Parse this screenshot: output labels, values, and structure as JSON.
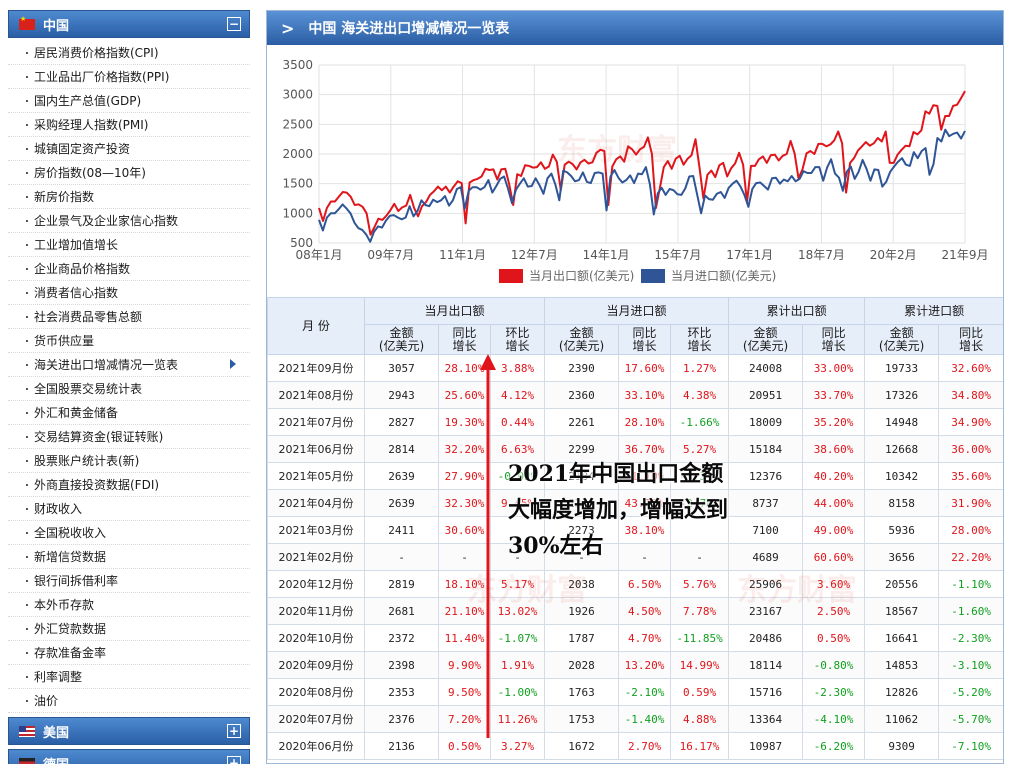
{
  "sidebar": {
    "groups": [
      {
        "name": "中国",
        "toggle": "−",
        "items": [
          "居民消费价格指数(CPI)",
          "工业品出厂价格指数(PPI)",
          "国内生产总值(GDP)",
          "采购经理人指数(PMI)",
          "城镇固定资产投资",
          "房价指数(08—10年)",
          "新房价指数",
          "企业景气及企业家信心指数",
          "工业增加值增长",
          "企业商品价格指数",
          "消费者信心指数",
          "社会消费品零售总额",
          "货币供应量",
          "海关进出口增减情况一览表",
          "全国股票交易统计表",
          "外汇和黄金储备",
          "交易结算资金(银证转账)",
          "股票账户统计表(新)",
          "外商直接投资数据(FDI)",
          "财政收入",
          "全国税收收入",
          "新增信贷数据",
          "银行间拆借利率",
          "本外币存款",
          "外汇贷款数据",
          "存款准备金率",
          "利率调整",
          "油价"
        ]
      },
      {
        "name": "美国",
        "toggle": "+"
      },
      {
        "name": "德国",
        "toggle": "+"
      }
    ]
  },
  "main": {
    "title": "中国 海关进出口增减情况一览表"
  },
  "chart_data": {
    "type": "line",
    "x_ticks": [
      "08年1月",
      "09年7月",
      "11年1月",
      "12年7月",
      "14年1月",
      "15年7月",
      "17年1月",
      "18年7月",
      "20年2月",
      "21年9月"
    ],
    "ylim": [
      500,
      3500
    ],
    "y_ticks": [
      500,
      1000,
      1500,
      2000,
      2500,
      3000,
      3500
    ],
    "grid": true,
    "legend_position": "bottom",
    "series": [
      {
        "name": "当月出口额(亿美元)",
        "color": "#e0151b",
        "values": [
          1090,
          870,
          1090,
          1200,
          1200,
          1280,
          1360,
          1350,
          1280,
          1140,
          1150,
          1110,
          1000,
          640,
          770,
          910,
          890,
          960,
          1050,
          1160,
          1040,
          1100,
          1130,
          1310,
          1090,
          950,
          1120,
          1190,
          1310,
          1370,
          1450,
          1390,
          1450,
          1350,
          1450,
          1540,
          1510,
          830,
          1520,
          1560,
          1580,
          1620,
          1750,
          1730,
          1740,
          1570,
          1740,
          1750,
          1490,
          1140,
          1660,
          1630,
          1810,
          1800,
          1770,
          1780,
          1860,
          1750,
          1790,
          1990,
          1870,
          1390,
          1820,
          1870,
          1830,
          1740,
          1860,
          1900,
          1840,
          1860,
          2020,
          2070,
          2050,
          1140,
          1790,
          1910,
          1960,
          1870,
          2130,
          2080,
          1990,
          2080,
          2120,
          2280,
          2000,
          1090,
          1420,
          1780,
          1880,
          1750,
          1920,
          1970,
          1820,
          1920,
          1980,
          2250,
          1770,
          1250,
          1650,
          1720,
          1610,
          1810,
          1850,
          1620,
          1760,
          1840,
          2020,
          1820,
          1190,
          1800,
          1800,
          1910,
          1960,
          1850,
          1980,
          1990,
          1890,
          1970,
          2000,
          2220,
          2010,
          1590,
          1740,
          2010,
          2050,
          2000,
          2170,
          2170,
          2130,
          2160,
          2230,
          2380,
          2180,
          1350,
          1850,
          1930,
          2060,
          2130,
          2200,
          2140,
          2180,
          2270,
          2210,
          2380,
          1850,
          1850,
          1990,
          2070,
          2140,
          2130,
          2370,
          2330,
          2400,
          2720,
          2680,
          2820,
          2810,
          2410,
          2640,
          2640,
          2810,
          2830,
          2940,
          3060
        ]
      },
      {
        "name": "当月进口额(亿美元)",
        "color": "#2f5597",
        "values": [
          890,
          710,
          930,
          1000,
          1000,
          1070,
          1150,
          1080,
          1000,
          840,
          750,
          720,
          640,
          520,
          690,
          780,
          760,
          880,
          960,
          970,
          930,
          900,
          930,
          1120,
          950,
          1040,
          1220,
          1140,
          1120,
          1230,
          1190,
          1220,
          1290,
          1130,
          1220,
          1410,
          1440,
          1080,
          1380,
          1440,
          1440,
          1400,
          1440,
          1560,
          1350,
          1460,
          1580,
          1620,
          1410,
          1170,
          1400,
          1500,
          1590,
          1450,
          1460,
          1590,
          1470,
          1330,
          1590,
          1670,
          1490,
          1220,
          1720,
          1690,
          1630,
          1540,
          1560,
          1690,
          1530,
          1510,
          1680,
          1690,
          1670,
          1050,
          1620,
          1730,
          1600,
          1520,
          1560,
          1640,
          1510,
          1670,
          1660,
          1780,
          1490,
          980,
          1340,
          1430,
          1310,
          1410,
          1390,
          1320,
          1310,
          1420,
          1620,
          1630,
          1320,
          1000,
          1300,
          1240,
          1230,
          1330,
          1360,
          1260,
          1430,
          1500,
          1550,
          1450,
          1310,
          1110,
          1410,
          1510,
          1520,
          1460,
          1400,
          1590,
          1600,
          1500,
          1570,
          1540,
          1630,
          1540,
          1580,
          1710,
          1680,
          1680,
          1780,
          1780,
          1550,
          1770,
          1910,
          1670,
          1600,
          1380,
          1700,
          1790,
          1580,
          1700,
          1900,
          1750,
          1550,
          1740,
          1730,
          1450,
          1530,
          1700,
          1790,
          1870,
          1930,
          1820,
          1800,
          2030,
          1930,
          2050,
          2100,
          1650,
          1830,
          2270,
          2210,
          2410,
          2300,
          2340,
          2360,
          2260,
          2390
        ]
      }
    ],
    "title": "",
    "xlabel": "",
    "ylabel": ""
  },
  "table": {
    "headers": {
      "month": "月    份",
      "groups": [
        "当月出口额",
        "当月进口额",
        "累计出口额",
        "累计进口额"
      ],
      "subs": [
        [
          "金额\n(亿美元)",
          "同比\n增长",
          "环比\n增长"
        ],
        [
          "金额\n(亿美元)",
          "同比\n增长",
          "环比\n增长"
        ],
        [
          "金额\n(亿美元)",
          "同比\n增长"
        ],
        [
          "金额\n(亿美元)",
          "同比\n增长"
        ]
      ]
    },
    "rows": [
      [
        "2021年09月份",
        "3057",
        "28.10%",
        "3.88%",
        "2390",
        "17.60%",
        "1.27%",
        "24008",
        "33.00%",
        "19733",
        "32.60%"
      ],
      [
        "2021年08月份",
        "2943",
        "25.60%",
        "4.12%",
        "2360",
        "33.10%",
        "4.38%",
        "20951",
        "33.70%",
        "17326",
        "34.80%"
      ],
      [
        "2021年07月份",
        "2827",
        "19.30%",
        "0.44%",
        "2261",
        "28.10%",
        "-1.66%",
        "18009",
        "35.20%",
        "14948",
        "34.90%"
      ],
      [
        "2021年06月份",
        "2814",
        "32.20%",
        "6.63%",
        "2299",
        "36.70%",
        "5.27%",
        "15184",
        "38.60%",
        "12668",
        "36.00%"
      ],
      [
        "2021年05月份",
        "2639",
        "27.90%",
        "-0.02%",
        "2184",
        "51.10%",
        "-1.37%",
        "12376",
        "40.20%",
        "10342",
        "35.60%"
      ],
      [
        "2021年04月份",
        "2639",
        "32.30%",
        "9.45%",
        "2211",
        "43.10%",
        "-2.78%",
        "8737",
        "44.00%",
        "8158",
        "31.90%"
      ],
      [
        "2021年03月份",
        "2411",
        "30.60%",
        "",
        "2273",
        "38.10%",
        "",
        "7100",
        "49.00%",
        "5936",
        "28.00%"
      ],
      [
        "2021年02月份",
        "-",
        "-",
        "-",
        "-",
        "-",
        "-",
        "4689",
        "60.60%",
        "3656",
        "22.20%"
      ],
      [
        "2020年12月份",
        "2819",
        "18.10%",
        "5.17%",
        "2038",
        "6.50%",
        "5.76%",
        "25906",
        "3.60%",
        "20556",
        "-1.10%"
      ],
      [
        "2020年11月份",
        "2681",
        "21.10%",
        "13.02%",
        "1926",
        "4.50%",
        "7.78%",
        "23167",
        "2.50%",
        "18567",
        "-1.60%"
      ],
      [
        "2020年10月份",
        "2372",
        "11.40%",
        "-1.07%",
        "1787",
        "4.70%",
        "-11.85%",
        "20486",
        "0.50%",
        "16641",
        "-2.30%"
      ],
      [
        "2020年09月份",
        "2398",
        "9.90%",
        "1.91%",
        "2028",
        "13.20%",
        "14.99%",
        "18114",
        "-0.80%",
        "14853",
        "-3.10%"
      ],
      [
        "2020年08月份",
        "2353",
        "9.50%",
        "-1.00%",
        "1763",
        "-2.10%",
        "0.59%",
        "15716",
        "-2.30%",
        "12826",
        "-5.20%"
      ],
      [
        "2020年07月份",
        "2376",
        "7.20%",
        "11.26%",
        "1753",
        "-1.40%",
        "4.88%",
        "13364",
        "-4.10%",
        "11062",
        "-5.70%"
      ],
      [
        "2020年06月份",
        "2136",
        "0.50%",
        "3.27%",
        "1672",
        "2.70%",
        "16.17%",
        "10987",
        "-6.20%",
        "9309",
        "-7.10%"
      ]
    ]
  },
  "annotation": {
    "lines": [
      "2021年中国出口金额",
      "大幅度增加，增幅达到",
      "30%左右"
    ],
    "color": "#e0151b"
  },
  "watermark": "东方财富"
}
